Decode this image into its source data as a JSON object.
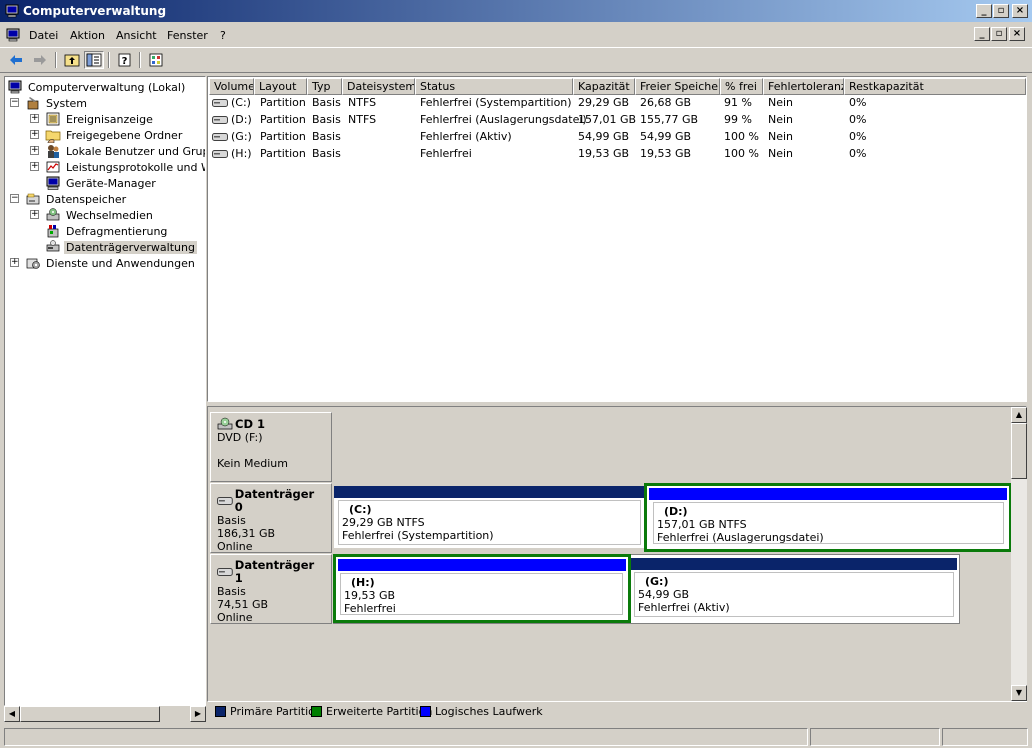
{
  "window": {
    "title": "Computerverwaltung"
  },
  "menu": [
    "Datei",
    "Aktion",
    "Ansicht",
    "Fenster",
    "?"
  ],
  "tree": {
    "root": "Computerverwaltung (Lokal)",
    "system": "System",
    "system_children": [
      "Ereignisanzeige",
      "Freigegebene Ordner",
      "Lokale Benutzer und Gruppen",
      "Leistungsprotokolle und Warnungen",
      "Geräte-Manager"
    ],
    "storage": "Datenspeicher",
    "storage_children": [
      "Wechselmedien",
      "Defragmentierung",
      "Datenträgerverwaltung"
    ],
    "services": "Dienste und Anwendungen"
  },
  "list": {
    "columns": [
      "Volume",
      "Layout",
      "Typ",
      "Dateisystem",
      "Status",
      "Kapazität",
      "Freier Speicher",
      "% frei",
      "Fehlertoleranz",
      "Restkapazität"
    ],
    "rows": [
      [
        "(C:)",
        "Partition",
        "Basis",
        "NTFS",
        "Fehlerfrei (Systempartition)",
        "29,29 GB",
        "26,68 GB",
        "91 %",
        "Nein",
        "0%"
      ],
      [
        "(D:)",
        "Partition",
        "Basis",
        "NTFS",
        "Fehlerfrei (Auslagerungsdatei)",
        "157,01 GB",
        "155,77 GB",
        "99 %",
        "Nein",
        "0%"
      ],
      [
        "(G:)",
        "Partition",
        "Basis",
        "",
        "Fehlerfrei (Aktiv)",
        "54,99 GB",
        "54,99 GB",
        "100 %",
        "Nein",
        "0%"
      ],
      [
        "(H:)",
        "Partition",
        "Basis",
        "",
        "Fehlerfrei",
        "19,53 GB",
        "19,53 GB",
        "100 %",
        "Nein",
        "0%"
      ]
    ]
  },
  "disks": [
    {
      "name": "CD 1",
      "line1": "DVD (F:)",
      "line2": "",
      "line3": "Kein Medium"
    },
    {
      "name": "Datenträger 0",
      "line1": "Basis",
      "line2": "186,31 GB",
      "line3": "Online",
      "partitions": [
        {
          "name": "(C:)",
          "size": "29,29 GB NTFS",
          "status": "Fehlerfrei (Systempartition)"
        },
        {
          "name": "(D:)",
          "size": "157,01 GB NTFS",
          "status": "Fehlerfrei (Auslagerungsdatei)"
        }
      ]
    },
    {
      "name": "Datenträger 1",
      "line1": "Basis",
      "line2": "74,51 GB",
      "line3": "Online",
      "partitions": [
        {
          "name": "(H:)",
          "size": "19,53 GB",
          "status": "Fehlerfrei"
        },
        {
          "name": "(G:)",
          "size": "54,99 GB",
          "status": "Fehlerfrei (Aktiv)"
        }
      ]
    }
  ],
  "legend": [
    "Primäre Partition",
    "Erweiterte Partition",
    "Logisches Laufwerk"
  ],
  "colors": {
    "primary": "#0a246a",
    "extended": "#008000",
    "logical": "#0000ff",
    "selected_outline": "#0a7a0a",
    "title_start": "#0a246a",
    "title_end": "#a6caf0"
  },
  "icons": [
    "computer-icon",
    "back-arrow-icon",
    "forward-arrow-icon",
    "up-folder-icon",
    "show-hide-tree-icon",
    "help-icon",
    "properties-icon",
    "event-viewer-icon",
    "shared-folder-icon",
    "users-icon",
    "performance-icon",
    "device-manager-icon",
    "storage-icon",
    "removable-media-icon",
    "defrag-icon",
    "disk-management-icon",
    "services-icon",
    "drive-icon",
    "cd-icon"
  ]
}
